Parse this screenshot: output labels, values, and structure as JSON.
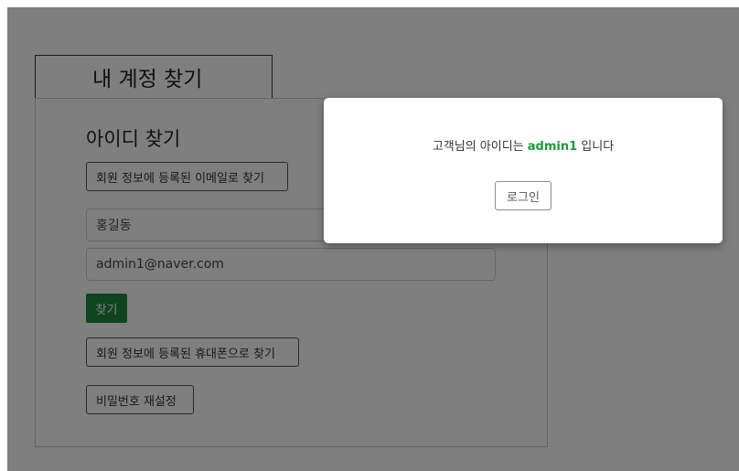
{
  "page": {
    "tab_title": "내 계정 찾기",
    "section_title": "아이디 찾기",
    "email_find_button": "회원 정보에 등록된 이메일로 찾기",
    "name_field_value": "홍길동",
    "email_field_value": "admin1@naver.com",
    "find_button": "찾기",
    "phone_find_button": "회원 정보에 등록된 휴대폰으로 찾기",
    "reset_password_button": "비밀번호 재설정"
  },
  "modal": {
    "message_prefix": "고객님의 아이디는 ",
    "user_id": "admin1",
    "message_suffix": " 입니다",
    "login_button": "로그인"
  },
  "colors": {
    "accent_green": "#1e8a3c",
    "overlay": "rgba(0,0,0,0.5)"
  }
}
